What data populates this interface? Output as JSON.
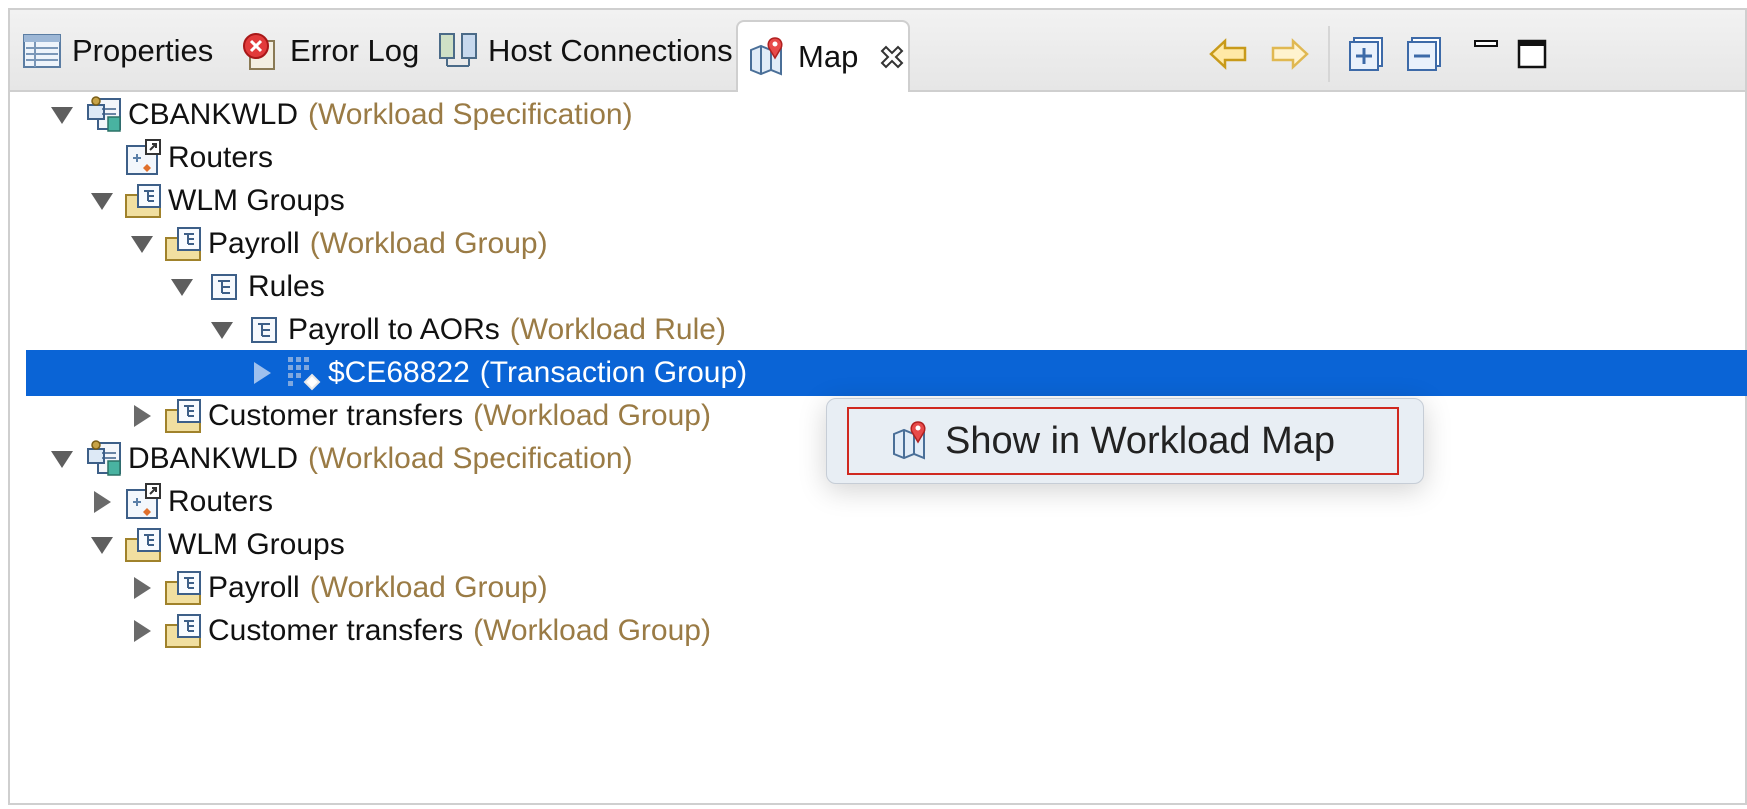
{
  "tabs": [
    {
      "label": "Properties",
      "icon": "properties-icon"
    },
    {
      "label": "Error Log",
      "icon": "error-log-icon"
    },
    {
      "label": "Host Connections",
      "icon": "host-connections-icon"
    },
    {
      "label": "Map",
      "icon": "map-icon",
      "active": true
    }
  ],
  "tree": [
    {
      "label": "CBANKWLD",
      "desc": "(Workload Specification)",
      "icon": "workload-spec-icon",
      "expanded": true,
      "level": 0
    },
    {
      "label": "Routers",
      "desc": "",
      "icon": "routers-icon",
      "expanded": null,
      "level": 1
    },
    {
      "label": "WLM Groups",
      "desc": "",
      "icon": "wlm-groups-icon",
      "expanded": true,
      "level": 1
    },
    {
      "label": "Payroll",
      "desc": "(Workload Group)",
      "icon": "workload-group-icon",
      "expanded": true,
      "level": 2
    },
    {
      "label": "Rules",
      "desc": "",
      "icon": "rules-icon",
      "expanded": true,
      "level": 3
    },
    {
      "label": "Payroll to AORs",
      "desc": "(Workload Rule)",
      "icon": "workload-rule-icon",
      "expanded": true,
      "level": 4
    },
    {
      "label": "$CE68822",
      "desc": "(Transaction Group)",
      "icon": "transaction-group-icon",
      "expanded": false,
      "level": 5,
      "selected": true
    },
    {
      "label": "Customer transfers",
      "desc": "(Workload Group)",
      "icon": "workload-group-icon",
      "expanded": false,
      "level": 2
    },
    {
      "label": "DBANKWLD",
      "desc": "(Workload Specification)",
      "icon": "workload-spec-icon",
      "expanded": true,
      "level": 0
    },
    {
      "label": "Routers",
      "desc": "",
      "icon": "routers-icon",
      "expanded": false,
      "level": 1
    },
    {
      "label": "WLM Groups",
      "desc": "",
      "icon": "wlm-groups-icon",
      "expanded": true,
      "level": 1
    },
    {
      "label": "Payroll",
      "desc": "(Workload Group)",
      "icon": "workload-group-icon",
      "expanded": false,
      "level": 2
    },
    {
      "label": "Customer transfers",
      "desc": "(Workload Group)",
      "icon": "workload-group-icon",
      "expanded": false,
      "level": 2
    }
  ],
  "context_menu": {
    "label": "Show in Workload Map",
    "icon": "map-icon"
  },
  "colors": {
    "selection": "#0a64d6",
    "description": "#9a7b45",
    "menu_highlight": "#d0281f"
  }
}
